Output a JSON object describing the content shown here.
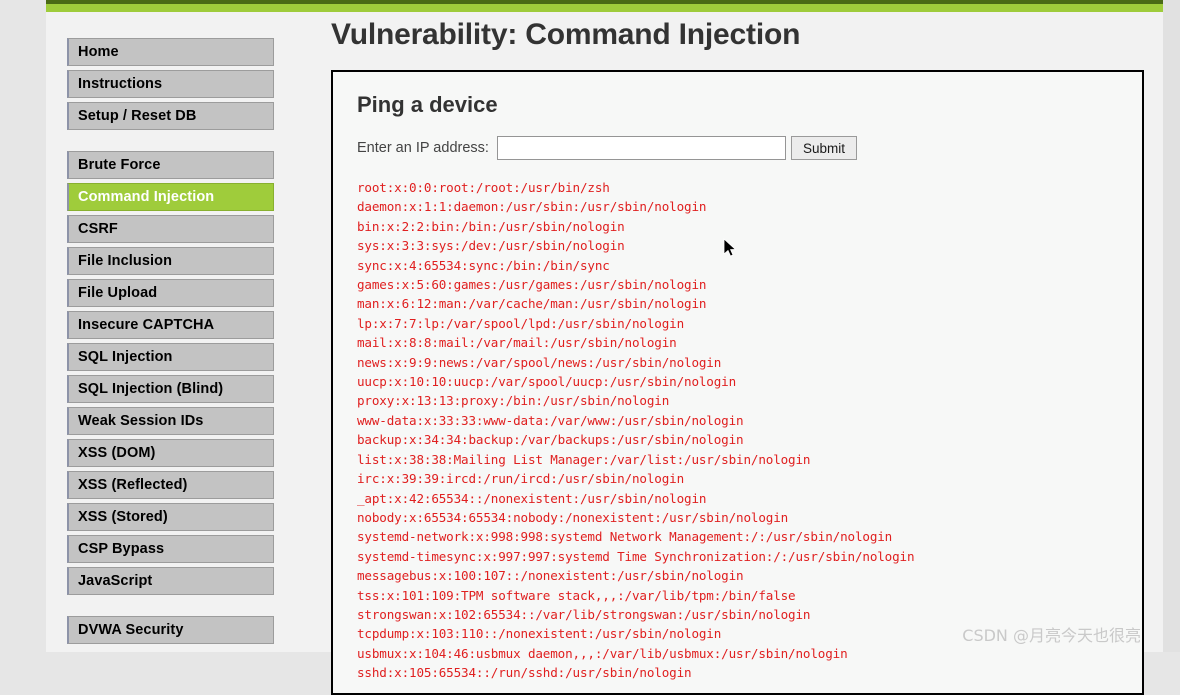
{
  "window": {
    "accent_green": "#9fcc3b",
    "accent_green_dark": "#4a6a15",
    "output_red": "#e02020"
  },
  "sidebar": {
    "groups": [
      {
        "items": [
          {
            "label": "Home",
            "active": false
          },
          {
            "label": "Instructions",
            "active": false
          },
          {
            "label": "Setup / Reset DB",
            "active": false
          }
        ]
      },
      {
        "items": [
          {
            "label": "Brute Force",
            "active": false
          },
          {
            "label": "Command Injection",
            "active": true
          },
          {
            "label": "CSRF",
            "active": false
          },
          {
            "label": "File Inclusion",
            "active": false
          },
          {
            "label": "File Upload",
            "active": false
          },
          {
            "label": "Insecure CAPTCHA",
            "active": false
          },
          {
            "label": "SQL Injection",
            "active": false
          },
          {
            "label": "SQL Injection (Blind)",
            "active": false
          },
          {
            "label": "Weak Session IDs",
            "active": false
          },
          {
            "label": "XSS (DOM)",
            "active": false
          },
          {
            "label": "XSS (Reflected)",
            "active": false
          },
          {
            "label": "XSS (Stored)",
            "active": false
          },
          {
            "label": "CSP Bypass",
            "active": false
          },
          {
            "label": "JavaScript",
            "active": false
          }
        ]
      },
      {
        "items": [
          {
            "label": "DVWA Security",
            "active": false
          }
        ]
      }
    ]
  },
  "main": {
    "page_title": "Vulnerability: Command Injection",
    "section_title": "Ping a device",
    "form": {
      "ip_label": "Enter an IP address:",
      "ip_value": "",
      "ip_placeholder": "",
      "submit_label": "Submit"
    },
    "command_output": "root:x:0:0:root:/root:/usr/bin/zsh\ndaemon:x:1:1:daemon:/usr/sbin:/usr/sbin/nologin\nbin:x:2:2:bin:/bin:/usr/sbin/nologin\nsys:x:3:3:sys:/dev:/usr/sbin/nologin\nsync:x:4:65534:sync:/bin:/bin/sync\ngames:x:5:60:games:/usr/games:/usr/sbin/nologin\nman:x:6:12:man:/var/cache/man:/usr/sbin/nologin\nlp:x:7:7:lp:/var/spool/lpd:/usr/sbin/nologin\nmail:x:8:8:mail:/var/mail:/usr/sbin/nologin\nnews:x:9:9:news:/var/spool/news:/usr/sbin/nologin\nuucp:x:10:10:uucp:/var/spool/uucp:/usr/sbin/nologin\nproxy:x:13:13:proxy:/bin:/usr/sbin/nologin\nwww-data:x:33:33:www-data:/var/www:/usr/sbin/nologin\nbackup:x:34:34:backup:/var/backups:/usr/sbin/nologin\nlist:x:38:38:Mailing List Manager:/var/list:/usr/sbin/nologin\nirc:x:39:39:ircd:/run/ircd:/usr/sbin/nologin\n_apt:x:42:65534::/nonexistent:/usr/sbin/nologin\nnobody:x:65534:65534:nobody:/nonexistent:/usr/sbin/nologin\nsystemd-network:x:998:998:systemd Network Management:/:/usr/sbin/nologin\nsystemd-timesync:x:997:997:systemd Time Synchronization:/:/usr/sbin/nologin\nmessagebus:x:100:107::/nonexistent:/usr/sbin/nologin\ntss:x:101:109:TPM software stack,,,:/var/lib/tpm:/bin/false\nstrongswan:x:102:65534::/var/lib/strongswan:/usr/sbin/nologin\ntcpdump:x:103:110::/nonexistent:/usr/sbin/nologin\nusbmux:x:104:46:usbmux daemon,,,:/var/lib/usbmux:/usr/sbin/nologin\nsshd:x:105:65534::/run/sshd:/usr/sbin/nologin"
  },
  "watermark": {
    "text": "CSDN @月亮今天也很亮"
  }
}
